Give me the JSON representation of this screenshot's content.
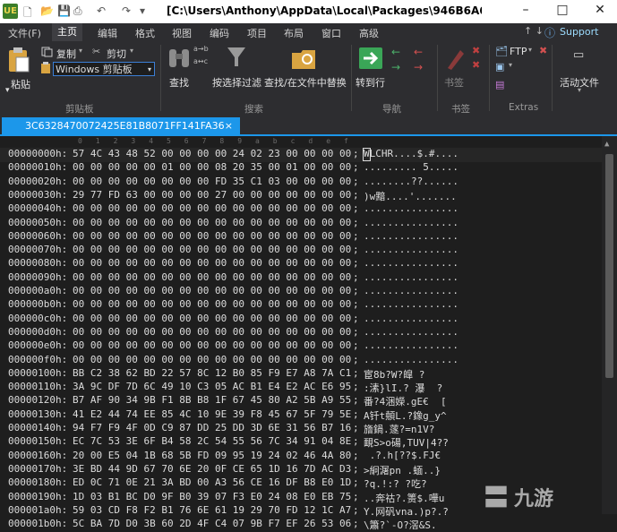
{
  "title_bar": {
    "app_logo": "UE",
    "title": "[C:\\Users\\Anthony\\AppData\\Local\\Packages\\946B6A6E.WoLongFalle..."
  },
  "menu": {
    "items": [
      "文件(F)",
      "主页",
      "编辑",
      "格式",
      "视图",
      "编码",
      "项目",
      "布局",
      "窗口",
      "高级"
    ],
    "active": "主页",
    "support": "Support"
  },
  "ribbon": {
    "paste": "粘贴",
    "copy": "复制",
    "cut": "剪切",
    "clipboard_select": "Windows 剪贴板",
    "find": "查找",
    "filter": "按选择过滤",
    "find_in_files": "查找/在文件中替换",
    "goto": "转到行",
    "bookmark": "书签",
    "ftp": "FTP",
    "active_files": "活动文件",
    "groups": [
      "剪贴板",
      "搜索",
      "导航",
      "书签",
      "Extras"
    ]
  },
  "tab": {
    "name": "3C6328470072425E81B8071FF141FA36",
    "close": "×"
  },
  "hex": {
    "column_headers": [
      "0",
      "1",
      "2",
      "3",
      "4",
      "5",
      "6",
      "7",
      "8",
      "9",
      "a",
      "b",
      "c",
      "d",
      "e",
      "f"
    ],
    "rows": [
      {
        "offset": "00000000h:",
        "hex": "57 4C 43 48 52 00 00 00 00 24 02 23 00 00 00 00",
        "sep": ";",
        "ascii": "WLCHR....$.#...."
      },
      {
        "offset": "00000010h:",
        "hex": "00 00 00 00 00 01 00 00 08 20 35 00 01 00 00 00",
        "sep": ";",
        "ascii": "......... 5....."
      },
      {
        "offset": "00000020h:",
        "hex": "00 00 00 00 00 00 00 00 FD 35 C1 03 00 00 00 00",
        "sep": ";",
        "ascii": "........??......"
      },
      {
        "offset": "00000030h:",
        "hex": "29 77 FD 63 00 00 00 00 27 00 00 00 00 00 00 00",
        "sep": ";",
        "ascii": ")w黯....'......."
      },
      {
        "offset": "00000040h:",
        "hex": "00 00 00 00 00 00 00 00 00 00 00 00 00 00 00 00",
        "sep": ";",
        "ascii": "................"
      },
      {
        "offset": "00000050h:",
        "hex": "00 00 00 00 00 00 00 00 00 00 00 00 00 00 00 00",
        "sep": ";",
        "ascii": "................"
      },
      {
        "offset": "00000060h:",
        "hex": "00 00 00 00 00 00 00 00 00 00 00 00 00 00 00 00",
        "sep": ";",
        "ascii": "................"
      },
      {
        "offset": "00000070h:",
        "hex": "00 00 00 00 00 00 00 00 00 00 00 00 00 00 00 00",
        "sep": ";",
        "ascii": "................"
      },
      {
        "offset": "00000080h:",
        "hex": "00 00 00 00 00 00 00 00 00 00 00 00 00 00 00 00",
        "sep": ";",
        "ascii": "................"
      },
      {
        "offset": "00000090h:",
        "hex": "00 00 00 00 00 00 00 00 00 00 00 00 00 00 00 00",
        "sep": ";",
        "ascii": "................"
      },
      {
        "offset": "000000a0h:",
        "hex": "00 00 00 00 00 00 00 00 00 00 00 00 00 00 00 00",
        "sep": ";",
        "ascii": "................"
      },
      {
        "offset": "000000b0h:",
        "hex": "00 00 00 00 00 00 00 00 00 00 00 00 00 00 00 00",
        "sep": ";",
        "ascii": "................"
      },
      {
        "offset": "000000c0h:",
        "hex": "00 00 00 00 00 00 00 00 00 00 00 00 00 00 00 00",
        "sep": ";",
        "ascii": "................"
      },
      {
        "offset": "000000d0h:",
        "hex": "00 00 00 00 00 00 00 00 00 00 00 00 00 00 00 00",
        "sep": ";",
        "ascii": "................"
      },
      {
        "offset": "000000e0h:",
        "hex": "00 00 00 00 00 00 00 00 00 00 00 00 00 00 00 00",
        "sep": ";",
        "ascii": "................"
      },
      {
        "offset": "000000f0h:",
        "hex": "00 00 00 00 00 00 00 00 00 00 00 00 00 00 00 00",
        "sep": ";",
        "ascii": "................"
      },
      {
        "offset": "00000100h:",
        "hex": "BB C2 38 62 BD 22 57 8C 12 B0 85 F9 E7 A8 7A C1",
        "sep": ";",
        "ascii": "宦8b?W?皡 ?"
      },
      {
        "offset": "00000110h:",
        "hex": "3A 9C DF 7D 6C 49 10 C3 05 AC B1 E4 E2 AC E6 95",
        "sep": ";",
        "ascii": ":溸}lI.? 瀑  ?"
      },
      {
        "offset": "00000120h:",
        "hex": "B7 AF 90 34 9B F1 8B B8 1F 67 45 80 A2 5B A9 55",
        "sep": ";",
        "ascii": "番?4涃嬫.gE€  ["
      },
      {
        "offset": "00000130h:",
        "hex": "41 E2 44 74 EE 85 4C 10 9E 39 F8 45 67 5F 79 5E",
        "sep": ";",
        "ascii": "A钎t顤L.?鐌g_y^"
      },
      {
        "offset": "00000140h:",
        "hex": "94 F7 F9 4F 0D C9 87 DD 25 DD 3D 6E 31 56 B7 16",
        "sep": ";",
        "ascii": "旝鍋.蓫?=n1V?"
      },
      {
        "offset": "00000150h:",
        "hex": "EC 7C 53 3E 6F B4 58 2C 54 55 56 7C 34 91 04 8E",
        "sep": ";",
        "ascii": "靦S>o碭,TUV|4??"
      },
      {
        "offset": "00000160h:",
        "hex": "20 00 E5 04 1B 68 5B FD 09 95 19 24 02 46 4A 80",
        "sep": ";",
        "ascii": " .?.h[??$.FJ€"
      },
      {
        "offset": "00000170h:",
        "hex": "3E BD 44 9D 67 70 6E 20 0F CE 65 1D 16 7D AC D3",
        "sep": ";",
        "ascii": ">絅潳pn .蝒..}"
      },
      {
        "offset": "00000180h:",
        "hex": "ED 0C 71 0E 21 3A BD 00 A3 56 CE 16 DF B8 E0 1D",
        "sep": ";",
        "ascii": "?q.!:? ?吃?"
      },
      {
        "offset": "00000190h:",
        "hex": "1D 03 B1 BC D0 9F B0 39 07 F3 E0 24 08 E0 EB 75",
        "sep": ";",
        "ascii": "..奔祜?.箦$.嘩u"
      },
      {
        "offset": "000001a0h:",
        "hex": "59 03 CD F8 F2 B1 76 6E 61 19 29 70 FD 12 1C A7",
        "sep": ";",
        "ascii": "Y.网矾vna.)p?.?"
      },
      {
        "offset": "000001b0h:",
        "hex": "5C BA 7D D0 3B 60 2D 4F C4 07 9B F7 EF 26 53 06",
        "sep": ";",
        "ascii": "\\簫?`-O?滘&S."
      }
    ]
  },
  "watermark": {
    "text": "九游"
  }
}
